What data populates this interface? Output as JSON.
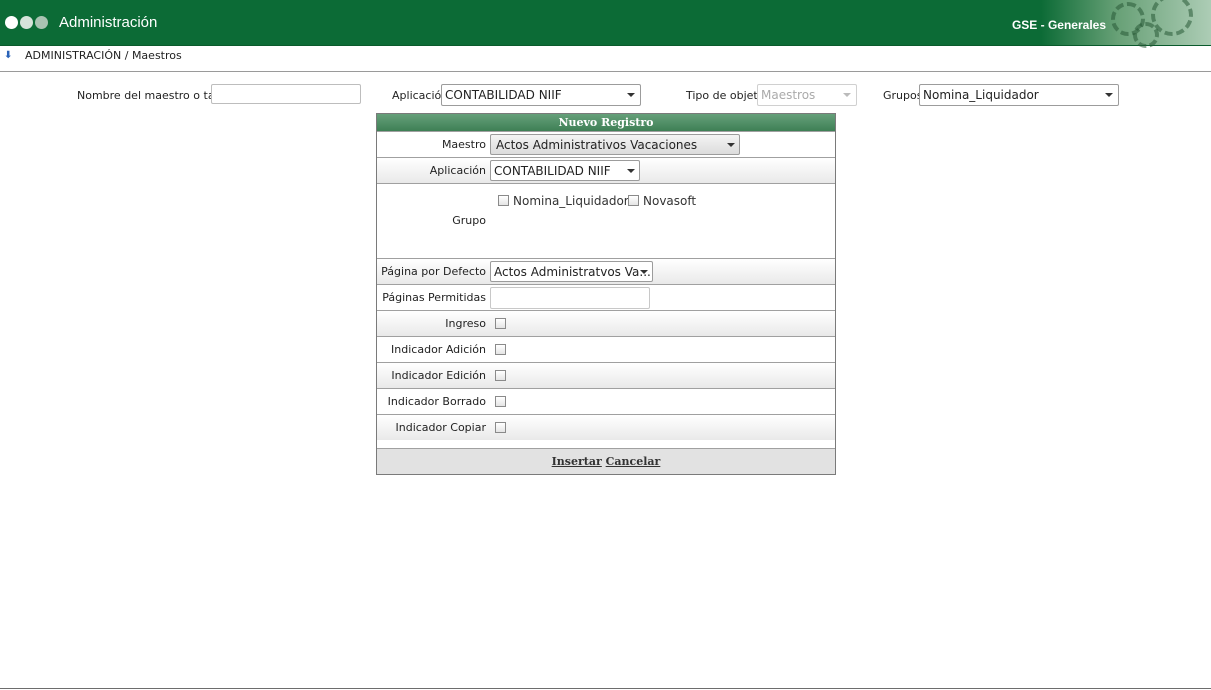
{
  "header": {
    "app_title": "Administración",
    "company": "GSE - Generales"
  },
  "breadcrumb": "ADMINISTRACIÓN / Maestros",
  "filters": {
    "nombre_label": "Nombre del maestro o tabla",
    "nombre_value": "",
    "aplicacion_label": "Aplicación",
    "aplicacion_value": "CONTABILIDAD NIIF",
    "tipo_label": "Tipo de objeto",
    "tipo_value": "Maestros",
    "grupos_label": "Grupos",
    "grupos_value": "Nomina_Liquidador"
  },
  "form": {
    "title": "Nuevo Registro",
    "maestro_label": "Maestro",
    "maestro_value": "Actos Administrativos Vacaciones",
    "aplicacion_label": "Aplicación",
    "aplicacion_value": "CONTABILIDAD NIIF",
    "grupo_label": "Grupo",
    "grupo_options": [
      "Nomina_Liquidador",
      "Novasoft"
    ],
    "pagina_defecto_label": "Página por Defecto",
    "pagina_defecto_value": "Actos Administratvos Va...",
    "paginas_permitidas_label": "Páginas Permitidas",
    "paginas_permitidas_value": "",
    "ingreso_label": "Ingreso",
    "adicion_label": "Indicador Adición",
    "edicion_label": "Indicador Edición",
    "borrado_label": "Indicador Borrado",
    "copiar_label": "Indicador Copiar",
    "insertar": "Insertar",
    "cancelar": "Cancelar"
  },
  "colors": {
    "header_green": "#0c6b36",
    "panel_head_green": "#4e8c63"
  }
}
